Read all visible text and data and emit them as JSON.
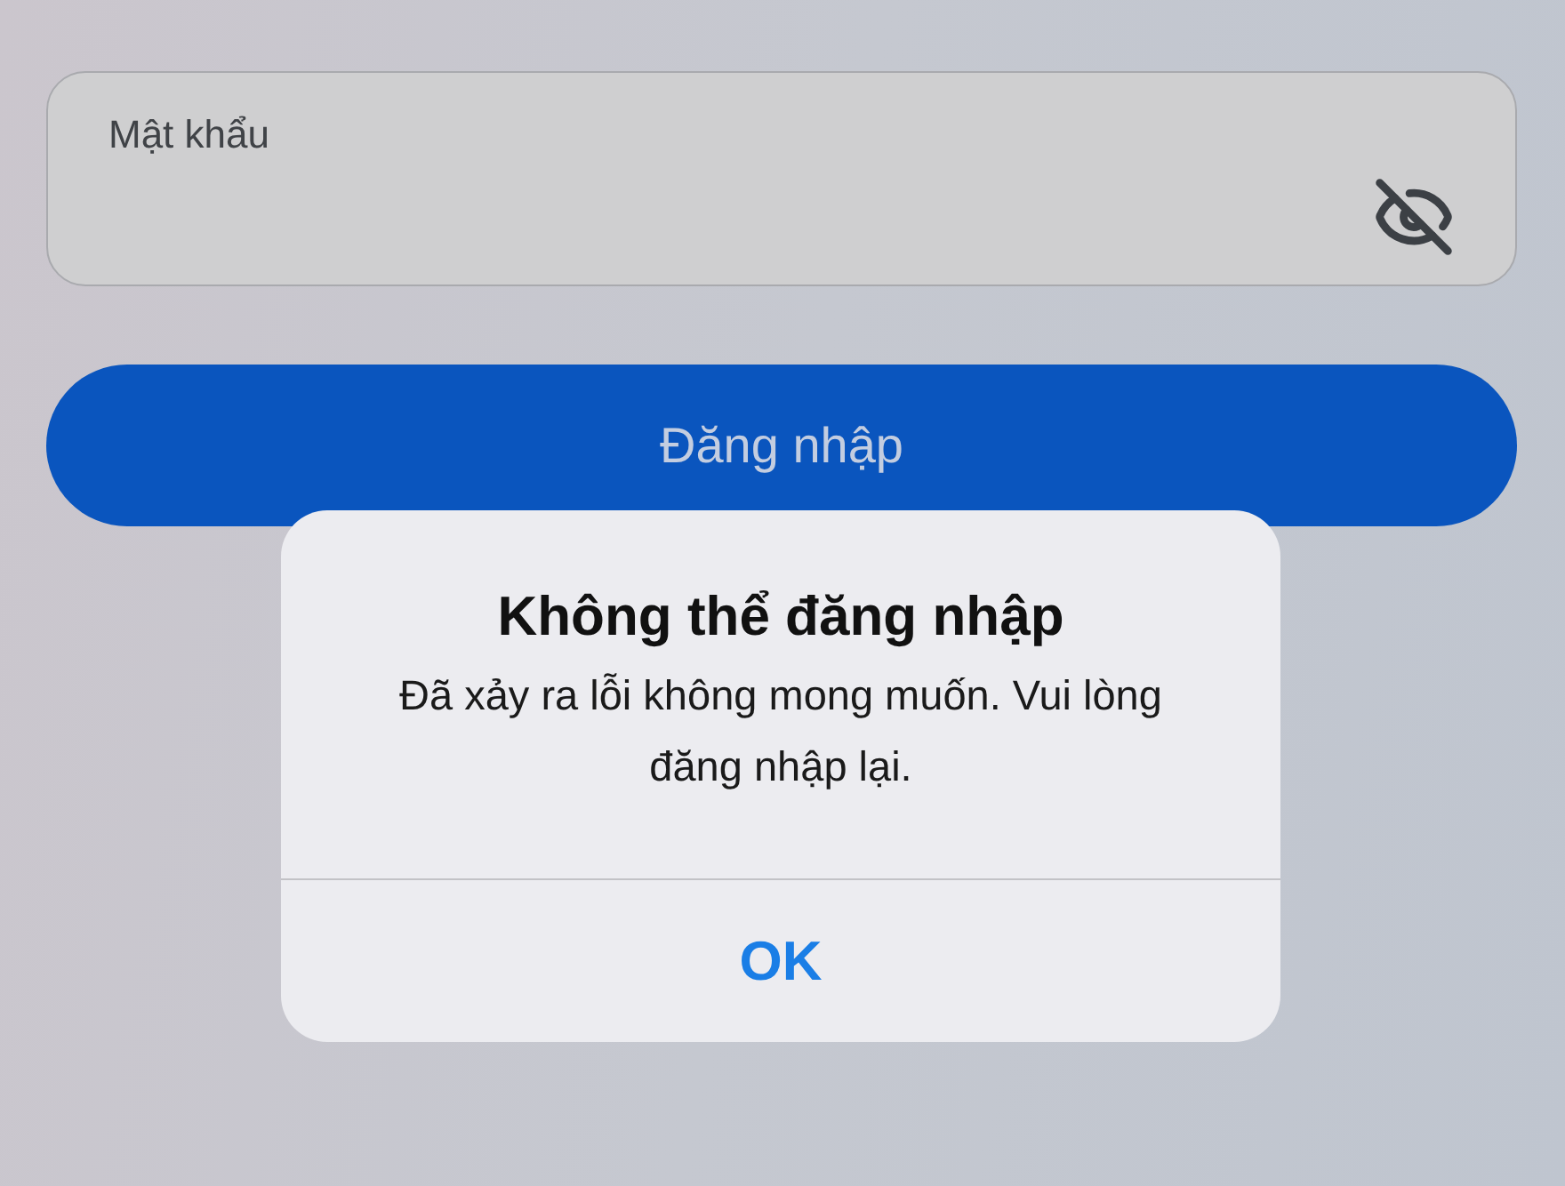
{
  "password_field": {
    "label": "Mật khẩu",
    "password_visible": false
  },
  "login_button": {
    "label": "Đăng nhập"
  },
  "alert": {
    "title": "Không thể đăng nhập",
    "message": "Đã xảy ra lỗi không mong muốn. Vui lòng đăng nhập lại.",
    "buttons": [
      "OK"
    ]
  }
}
